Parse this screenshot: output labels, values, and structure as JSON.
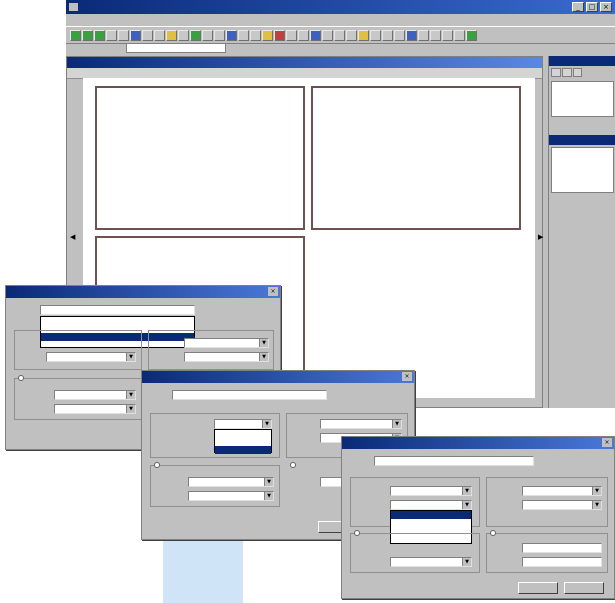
{
  "app": {
    "title": "",
    "doc_title": "",
    "menus": [],
    "field_value": ""
  },
  "dialogs": [
    {
      "name_label": "",
      "name_value": "",
      "dropdown_items": [],
      "selected_index": 0
    },
    {
      "name_label": "",
      "name_value": "",
      "dropdown_items": [],
      "selected_index": 0
    },
    {
      "name_label": "",
      "name_value": "",
      "dropdown_items": [],
      "selected_index": 0,
      "ok_label": "",
      "cancel_label": ""
    }
  ],
  "colors": {
    "title_bar": "#0a2a78",
    "panel_border": "#6e5252",
    "chrome": "#c0c0c0",
    "accent_strip": "#cfe4f6"
  }
}
